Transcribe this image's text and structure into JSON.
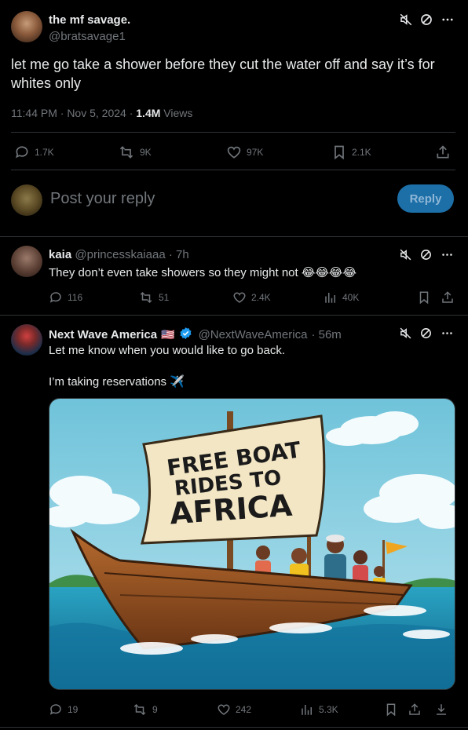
{
  "main_tweet": {
    "name": "the mf savage.",
    "handle": "@bratsavage1",
    "text": "let me go take a shower before they cut the water off and say it’s for whites only",
    "time": "11:44 PM · Nov 5, 2024 ·",
    "views_count": "1.4M",
    "views_label": "Views",
    "replies": "1.7K",
    "reposts": "9K",
    "likes": "97K",
    "bookmarks": "2.1K"
  },
  "composer": {
    "placeholder": "Post your reply",
    "button_label": "Reply",
    "accent": "#1d9bf0"
  },
  "replies": [
    {
      "name": "kaia",
      "handle": "@princesskaiaaa",
      "time": "· 7h",
      "text": "They don’t even take showers so they might not",
      "emoji": "😂😂😂😂",
      "replies": "116",
      "reposts": "51",
      "likes": "2.4K",
      "views": "40K"
    },
    {
      "name": "Next Wave America",
      "flag": "🇺🇸",
      "handle": "@NextWaveAmerica",
      "time": "· 56m",
      "text_line1": "Let me know when you would like to go back.",
      "text_line2": "I’m taking reservations",
      "text_emoji": "✈️",
      "image_sign_lines": [
        "FREE BOAT",
        "RIDES TO",
        "AFRICA"
      ],
      "replies": "19",
      "reposts": "9",
      "likes": "242",
      "views": "5.3K"
    }
  ]
}
